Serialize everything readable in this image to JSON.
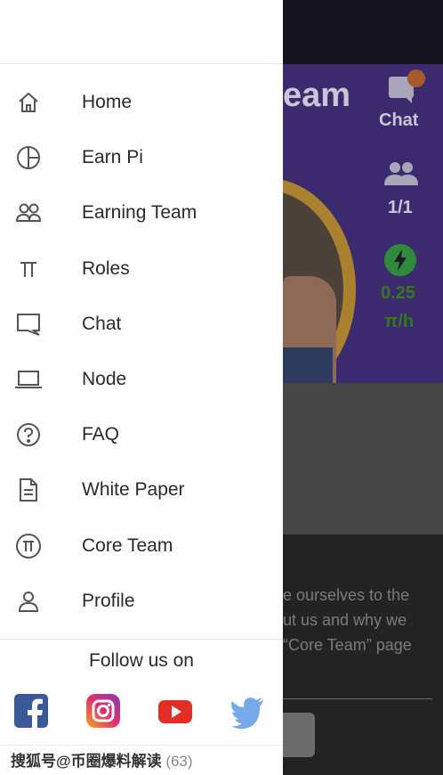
{
  "background": {
    "hero_title_fragment": "eam",
    "chat_label": "Chat",
    "team_count": "1/1",
    "mining_rate": "0.25",
    "mining_unit": "π/h",
    "text_lines": [
      "e ourselves to the",
      "ut us and why we",
      "“Core Team” page"
    ]
  },
  "drawer": {
    "menu": [
      {
        "label": "Home",
        "icon": "home-icon"
      },
      {
        "label": "Earn Pi",
        "icon": "pie-chart-icon"
      },
      {
        "label": "Earning Team",
        "icon": "team-icon"
      },
      {
        "label": "Roles",
        "icon": "pi-symbol-icon"
      },
      {
        "label": "Chat",
        "icon": "chat-icon"
      },
      {
        "label": "Node",
        "icon": "laptop-icon"
      },
      {
        "label": "FAQ",
        "icon": "question-icon"
      },
      {
        "label": "White Paper",
        "icon": "document-icon"
      },
      {
        "label": "Core Team",
        "icon": "pi-coin-icon"
      },
      {
        "label": "Profile",
        "icon": "person-icon"
      }
    ],
    "follow_label": "Follow us on",
    "social": [
      "facebook-icon",
      "instagram-icon",
      "youtube-icon",
      "twitter-icon"
    ],
    "watermark": "搜狐号@币圈爆料解读",
    "version_number": "(63)"
  },
  "colors": {
    "facebook": "#3b5998",
    "youtube": "#e52d27",
    "twitter": "#76a9ea",
    "hero_purple": "#3c2a6e",
    "rate_green": "#33781f"
  }
}
